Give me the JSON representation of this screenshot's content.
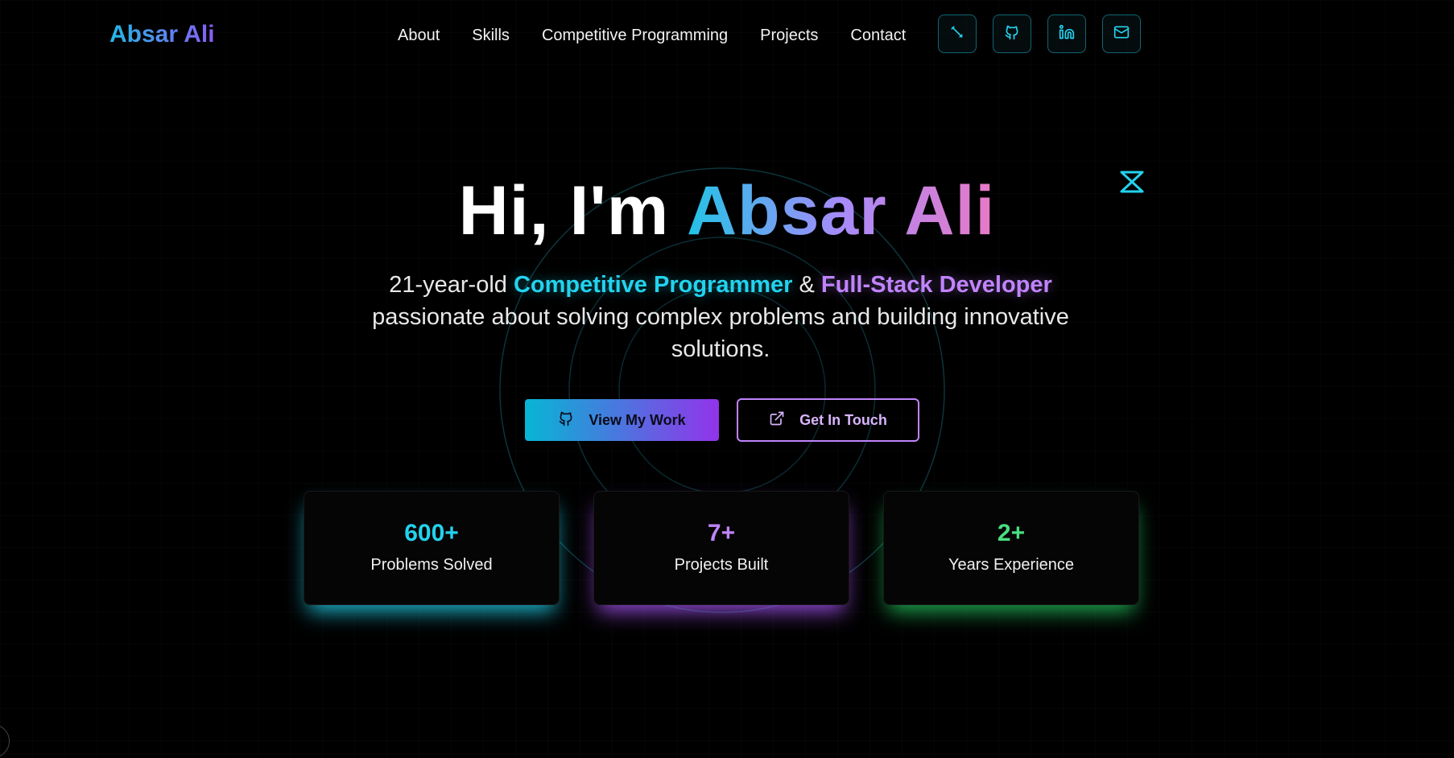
{
  "brand": "Absar Ali",
  "nav": {
    "links": [
      "About",
      "Skills",
      "Competitive Programming",
      "Projects",
      "Contact"
    ],
    "icons": [
      "code-icon",
      "github-icon",
      "linkedin-icon",
      "mail-icon"
    ]
  },
  "hero": {
    "greeting": "Hi, I'm ",
    "name": "Absar Ali",
    "sub_prefix": "21-year-old ",
    "role1": "Competitive Programmer",
    "connector": " & ",
    "role2": "Full-Stack Developer",
    "sub_rest": "passionate about solving complex problems and building innovative solutions."
  },
  "buttons": {
    "primary": "View My Work",
    "secondary": "Get In Touch"
  },
  "stats": [
    {
      "value": "600+",
      "label": "Problems Solved",
      "color": "#22d3ee"
    },
    {
      "value": "7+",
      "label": "Projects Built",
      "color": "#c084fc"
    },
    {
      "value": "2+",
      "label": "Years Experience",
      "color": "#4ade80"
    }
  ],
  "colors": {
    "accent_cyan": "#22d3ee",
    "accent_purple": "#c084fc",
    "accent_green": "#4ade80",
    "background": "#000000"
  }
}
